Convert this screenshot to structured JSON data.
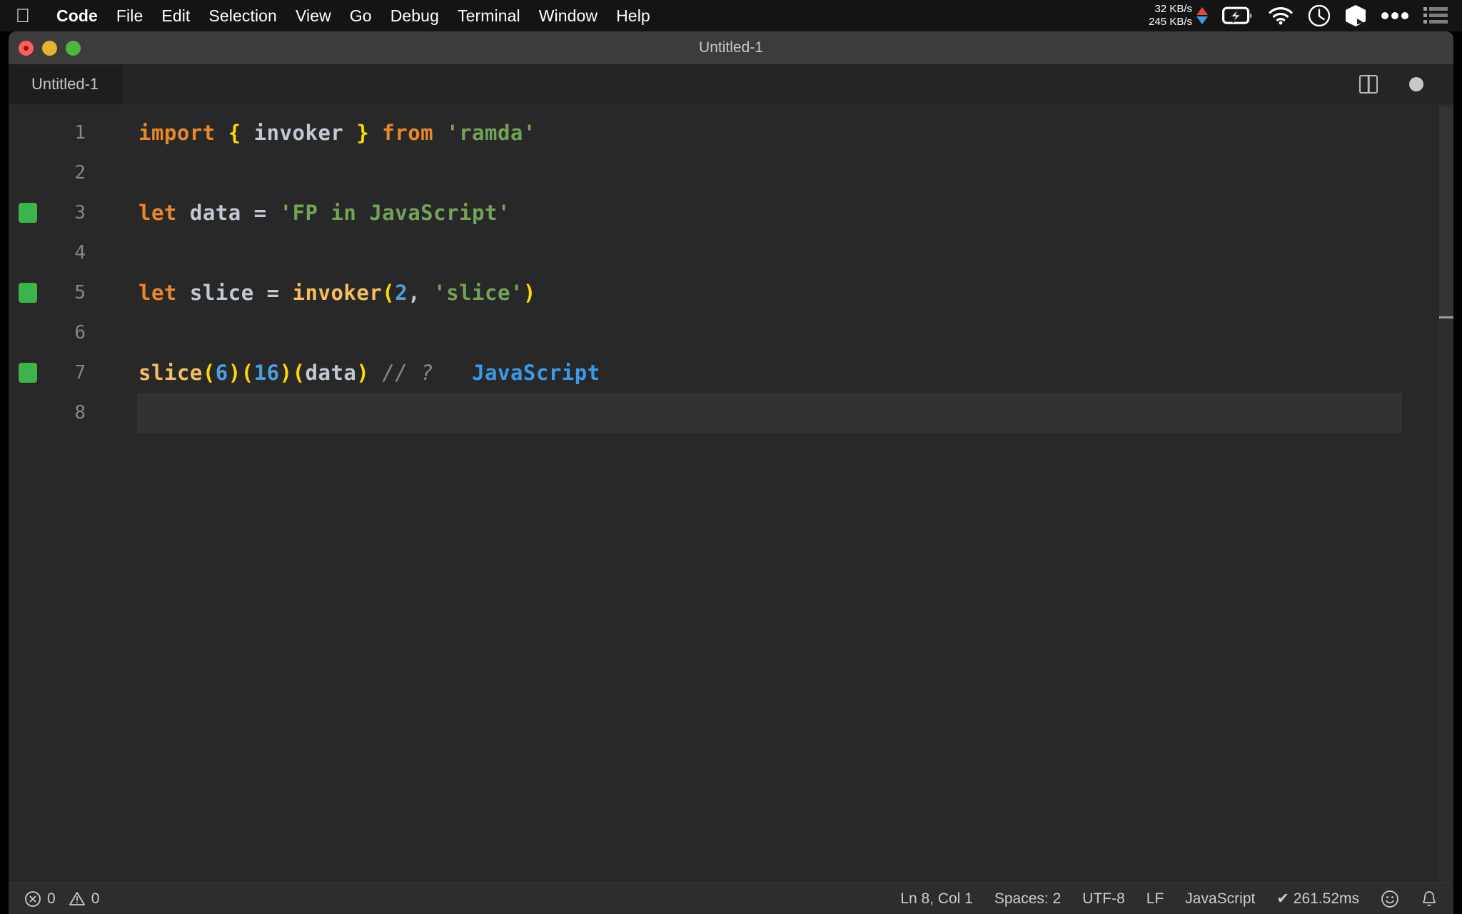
{
  "menubar": {
    "apple_icon": "apple-logo",
    "items": [
      {
        "label": "Code",
        "bold": true
      },
      {
        "label": "File"
      },
      {
        "label": "Edit"
      },
      {
        "label": "Selection"
      },
      {
        "label": "View"
      },
      {
        "label": "Go"
      },
      {
        "label": "Debug"
      },
      {
        "label": "Terminal"
      },
      {
        "label": "Window"
      },
      {
        "label": "Help"
      }
    ],
    "status": {
      "net_up": "32 KB/s",
      "net_down": "245 KB/s",
      "up_arrow_color": "#e8453c",
      "down_arrow_color": "#3a9ae8",
      "icons": [
        "battery-charging-icon",
        "wifi-icon",
        "clock-icon",
        "app-cube-icon",
        "ellipsis-icon",
        "control-center-icon"
      ]
    }
  },
  "window": {
    "title": "Untitled-1",
    "traffic_lights": [
      "close",
      "minimize",
      "maximize"
    ]
  },
  "tabbar": {
    "active_tab": "Untitled-1",
    "actions": [
      "split-editor-icon",
      "unsaved-dot-icon"
    ]
  },
  "editor": {
    "language": "JavaScript",
    "lines": [
      {
        "number": "1",
        "gutter": false,
        "current": false,
        "tokens": [
          {
            "t": "import",
            "c": "kw"
          },
          {
            "t": " ",
            "c": "punc"
          },
          {
            "t": "{",
            "c": "brace"
          },
          {
            "t": " ",
            "c": "punc"
          },
          {
            "t": "invoker",
            "c": "var"
          },
          {
            "t": " ",
            "c": "punc"
          },
          {
            "t": "}",
            "c": "brace"
          },
          {
            "t": " ",
            "c": "punc"
          },
          {
            "t": "from",
            "c": "kw"
          },
          {
            "t": " ",
            "c": "punc"
          },
          {
            "t": "'ramda'",
            "c": "str"
          }
        ]
      },
      {
        "number": "2",
        "gutter": false,
        "current": false,
        "tokens": []
      },
      {
        "number": "3",
        "gutter": true,
        "current": false,
        "tokens": [
          {
            "t": "let",
            "c": "kw"
          },
          {
            "t": " ",
            "c": "punc"
          },
          {
            "t": "data",
            "c": "var"
          },
          {
            "t": " ",
            "c": "punc"
          },
          {
            "t": "=",
            "c": "op"
          },
          {
            "t": " ",
            "c": "punc"
          },
          {
            "t": "'FP in JavaScript'",
            "c": "str"
          }
        ]
      },
      {
        "number": "4",
        "gutter": false,
        "current": false,
        "tokens": []
      },
      {
        "number": "5",
        "gutter": true,
        "current": false,
        "tokens": [
          {
            "t": "let",
            "c": "kw"
          },
          {
            "t": " ",
            "c": "punc"
          },
          {
            "t": "slice",
            "c": "var"
          },
          {
            "t": " ",
            "c": "punc"
          },
          {
            "t": "=",
            "c": "op"
          },
          {
            "t": " ",
            "c": "punc"
          },
          {
            "t": "invoker",
            "c": "fn"
          },
          {
            "t": "(",
            "c": "brace"
          },
          {
            "t": "2",
            "c": "num"
          },
          {
            "t": ",",
            "c": "punc"
          },
          {
            "t": " ",
            "c": "punc"
          },
          {
            "t": "'slice'",
            "c": "str"
          },
          {
            "t": ")",
            "c": "brace"
          }
        ]
      },
      {
        "number": "6",
        "gutter": false,
        "current": false,
        "tokens": []
      },
      {
        "number": "7",
        "gutter": true,
        "current": false,
        "tokens": [
          {
            "t": "slice",
            "c": "fn"
          },
          {
            "t": "(",
            "c": "brace"
          },
          {
            "t": "6",
            "c": "num"
          },
          {
            "t": ")",
            "c": "brace"
          },
          {
            "t": "(",
            "c": "brace"
          },
          {
            "t": "16",
            "c": "num"
          },
          {
            "t": ")",
            "c": "brace"
          },
          {
            "t": "(",
            "c": "brace"
          },
          {
            "t": "data",
            "c": "var"
          },
          {
            "t": ")",
            "c": "brace"
          },
          {
            "t": " ",
            "c": "punc"
          },
          {
            "t": "// ?",
            "c": "comment"
          },
          {
            "t": "   ",
            "c": "punc"
          },
          {
            "t": "JavaScript",
            "c": "result"
          }
        ]
      },
      {
        "number": "8",
        "gutter": false,
        "current": true,
        "tokens": []
      }
    ]
  },
  "statusbar": {
    "errors_icon": "error-circle-icon",
    "errors": "0",
    "warnings_icon": "warning-triangle-icon",
    "warnings": "0",
    "cursor_position": "Ln 8, Col 1",
    "indentation": "Spaces: 2",
    "encoding": "UTF-8",
    "eol": "LF",
    "language_mode": "JavaScript",
    "run_status": "✔ 261.52ms",
    "feedback_icon": "smiley-icon",
    "notifications_icon": "bell-icon"
  },
  "colors": {
    "menubar_bg": "#141414",
    "titlebar_bg": "#3c3c3c",
    "tabbar_bg": "#252526",
    "editor_bg": "#282828",
    "statusbar_bg": "#2d2d2d",
    "git_added": "#3cb44b",
    "accent_blue": "#3a9ae8"
  }
}
